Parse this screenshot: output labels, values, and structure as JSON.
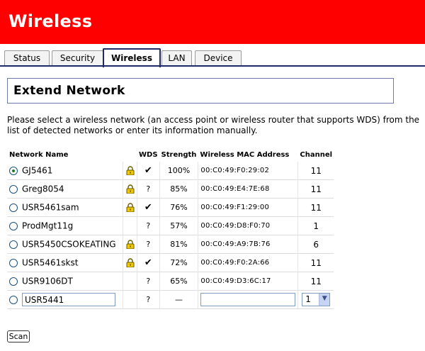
{
  "header": {
    "title": "Wireless"
  },
  "tabs": [
    {
      "label": "Status"
    },
    {
      "label": "Security"
    },
    {
      "label": "Wireless"
    },
    {
      "label": "LAN"
    },
    {
      "label": "Device"
    }
  ],
  "section": {
    "title": "Extend Network"
  },
  "intro": "Please select a wireless network (an access point or wireless router that supports WDS) from the list of detected networks or enter its information manually.",
  "table": {
    "headers": {
      "name": "Network Name",
      "wds": "WDS",
      "strength": "Strength",
      "mac": "Wireless MAC Address",
      "channel": "Channel"
    },
    "rows": [
      {
        "name": "GJ5461",
        "locked": true,
        "wds": "✔",
        "strength": "100%",
        "mac": "00:C0:49:F0:29:02",
        "channel": "11",
        "selected": true
      },
      {
        "name": "Greg8054",
        "locked": true,
        "wds": "?",
        "strength": "85%",
        "mac": "00:C0:49:E4:7E:68",
        "channel": "11",
        "selected": false
      },
      {
        "name": "USR5461sam",
        "locked": true,
        "wds": "✔",
        "strength": "76%",
        "mac": "00:C0:49:F1:29:00",
        "channel": "11",
        "selected": false
      },
      {
        "name": "ProdMgt11g",
        "locked": false,
        "wds": "?",
        "strength": "57%",
        "mac": "00:C0:49:D8:F0:70",
        "channel": "1",
        "selected": false
      },
      {
        "name": "USR5450CSOKEATING",
        "locked": true,
        "wds": "?",
        "strength": "81%",
        "mac": "00:C0:49:A9:7B:76",
        "channel": "6",
        "selected": false
      },
      {
        "name": "USR5461skst",
        "locked": true,
        "wds": "✔",
        "strength": "72%",
        "mac": "00:C0:49:F0:2A:66",
        "channel": "11",
        "selected": false
      },
      {
        "name": "USR9106DT",
        "locked": false,
        "wds": "?",
        "strength": "65%",
        "mac": "00:C0:49:D3:6C:17",
        "channel": "11",
        "selected": false
      }
    ],
    "manual_row": {
      "name_value": "USR5441",
      "wds": "?",
      "strength": "—",
      "mac_value": "",
      "channel_value": "1"
    }
  },
  "scan_button": "Scan",
  "colors": {
    "header_bg": "#ff0000",
    "accent": "#1f2a6b"
  }
}
